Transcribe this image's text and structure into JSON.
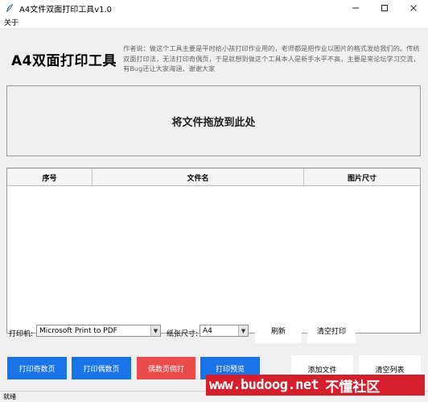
{
  "window": {
    "title": "A4文件双面打印工具v1.0",
    "icon": "feather-icon",
    "controls": [
      "minimize-icon",
      "maximize-icon",
      "close-icon"
    ]
  },
  "menu": {
    "items": [
      "关于"
    ]
  },
  "header": {
    "app_title": "A4双面打印工具",
    "description": "作者说：做这个工具主要是平时给小孩打印作业用的，老师都是把作业以图片的格式发给我们的。传统双面打印法，无法打印奇偶页，于是就想到做这个工具本人是新手水平不高，主要是来论坛学习交流，有Bug还让大家海涵，谢谢大家"
  },
  "dropzone": {
    "text": "将文件拖放到此处"
  },
  "table": {
    "columns": [
      "序号",
      "文件名",
      "图片尺寸"
    ],
    "rows": []
  },
  "controls": {
    "printer_label": "打印机:",
    "printer_value": "Microsoft Print to PDF",
    "paper_label": "纸张尺寸:",
    "paper_value": "A4",
    "refresh_label": "刷新",
    "clear_print_label": "清空打印"
  },
  "actions": {
    "print_odd": "打印奇数页",
    "print_even": "打印偶数页",
    "even_reverse": "偶数页倒打",
    "preview": "打印预览",
    "add_file": "添加文件",
    "clear_list": "清空列表"
  },
  "status": {
    "text": "就绪"
  },
  "watermark": {
    "url": "www.budoog.net",
    "name": "不懂社区"
  },
  "colors": {
    "blue_button": "#1a73e8",
    "red_button": "#eb4b4b",
    "window_bg": "#f0f0f0",
    "watermark_bg": "#d61f2c"
  }
}
